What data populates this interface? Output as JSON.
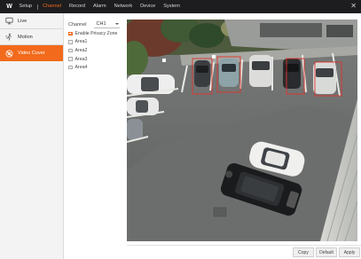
{
  "app": {
    "logo": "W"
  },
  "menu": {
    "items": [
      {
        "label": "Setup",
        "active": false
      },
      {
        "label": "Channel",
        "active": true
      },
      {
        "label": "Record",
        "active": false
      },
      {
        "label": "Alarm",
        "active": false
      },
      {
        "label": "Network",
        "active": false
      },
      {
        "label": "Device",
        "active": false
      },
      {
        "label": "System",
        "active": false
      }
    ],
    "close_glyph": "✕"
  },
  "sidebar": {
    "items": [
      {
        "label": "Live",
        "icon": "monitor-icon",
        "active": false
      },
      {
        "label": "Motion",
        "icon": "motion-icon",
        "active": false
      },
      {
        "label": "Video Cover",
        "icon": "video-cover-icon",
        "active": true
      }
    ]
  },
  "settings": {
    "channel_label": "Channel",
    "channel_value": "CH1",
    "enable_label": "Enable Privacy Zone",
    "enable_checked": true,
    "areas": [
      {
        "label": "Area1",
        "checked": false
      },
      {
        "label": "Area2",
        "checked": false
      },
      {
        "label": "Area3",
        "checked": false
      },
      {
        "label": "Area4",
        "checked": false
      }
    ]
  },
  "buttons": {
    "copy": "Copy",
    "default": "Default",
    "apply": "Apply"
  },
  "colors": {
    "accent": "#f26a1b",
    "topbar": "#1d1d1f",
    "motion_box": "#e0342a"
  }
}
